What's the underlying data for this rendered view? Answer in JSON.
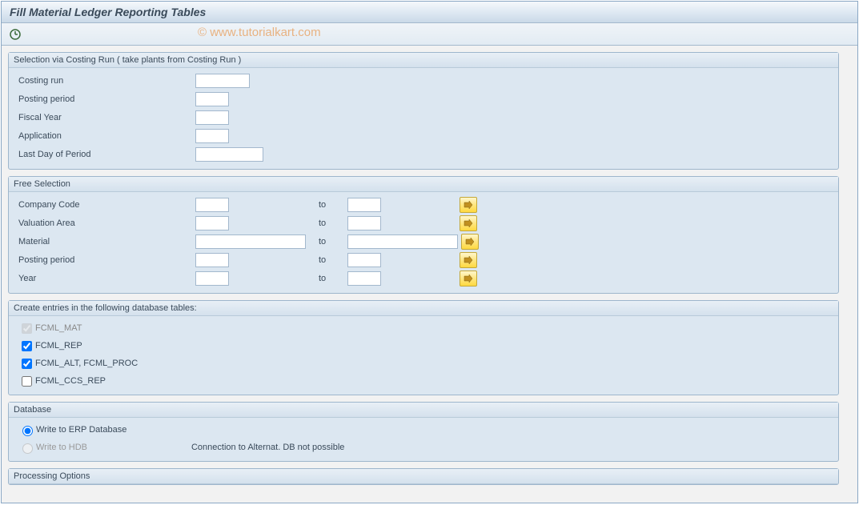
{
  "title": "Fill Material Ledger Reporting Tables",
  "watermark": "© www.tutorialkart.com",
  "groups": {
    "costing": {
      "title": "Selection via Costing Run ( take plants from Costing Run )",
      "fields": {
        "costing_run": "Costing run",
        "posting_period": "Posting period",
        "fiscal_year": "Fiscal Year",
        "application": "Application",
        "last_day": "Last Day of Period"
      }
    },
    "free": {
      "title": "Free Selection",
      "to_label": "to",
      "fields": {
        "company_code": "Company Code",
        "valuation_area": "Valuation Area",
        "material": "Material",
        "posting_period": "Posting period",
        "year": "Year"
      }
    },
    "create": {
      "title": "Create entries in the following database tables:",
      "options": {
        "fcml_mat": "FCML_MAT",
        "fcml_rep": "FCML_REP",
        "fcml_alt": "FCML_ALT, FCML_PROC",
        "fcml_ccs": "FCML_CCS_REP"
      }
    },
    "database": {
      "title": "Database",
      "erp": "Write to ERP Database",
      "hdb": "Write to HDB",
      "hdb_msg": "Connection to Alternat. DB not possible"
    },
    "processing": {
      "title": "Processing Options"
    }
  }
}
